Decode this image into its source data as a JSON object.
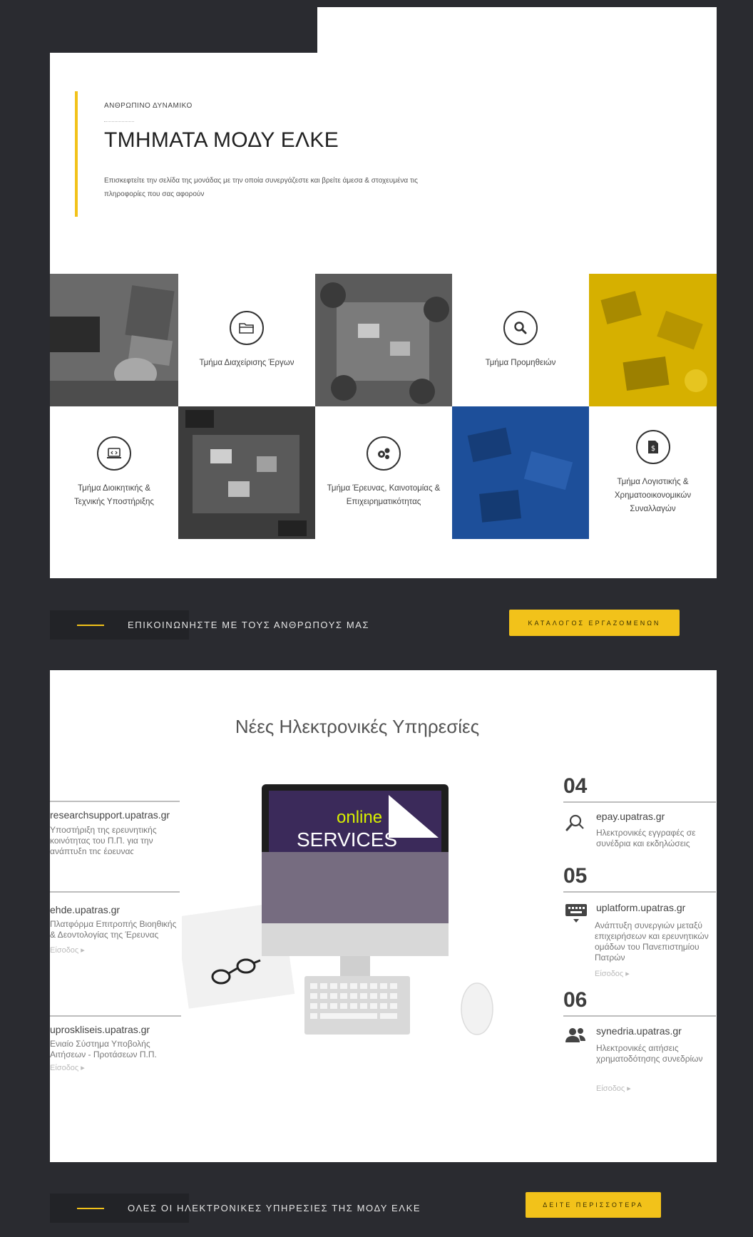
{
  "hero": {
    "eyebrow": "ΑΝΘΡΩΠΙΝΟ ΔΥΝΑΜΙΚΟ",
    "title": "ΤΜΗΜΑΤΑ ΜΟΔΥ ΕΛΚΕ",
    "description": "Επισκεφτείτε την σελίδα της μονάδας με την οποία συνεργάζεστε και βρείτε άμεσα & στοχευμένα τις πληροφορίες που σας αφορούν"
  },
  "departments": [
    {
      "label": "Τμήμα Διαχείρισης Έργων",
      "icon": "folder-icon"
    },
    {
      "label": "Τμήμα Προμηθειών",
      "icon": "search-icon"
    },
    {
      "label": "Τμήμα Διοικητικής & Τεχνικής Υποστήριξης",
      "icon": "laptop-icon"
    },
    {
      "label": "Τμήμα Έρευνας, Καινοτομίας & Επιχειρηματικότητας",
      "icon": "gears-icon"
    },
    {
      "label": "Τμήμα Λογιστικής & Χρηματοοικονομικών Συναλλαγών",
      "icon": "dollar-document-icon"
    }
  ],
  "band1": {
    "text": "ΕΠΙΚΟΙΝΩΝΗΣΤΕ ΜΕ ΤΟΥΣ ΑΝΘΡΩΠΟΥΣ ΜΑΣ",
    "button": "ΚΑΤΑΛΟΓΟΣ ΕΡΓΑΖΟΜΕΝΩΝ"
  },
  "services": {
    "title": "Νέες Ηλεκτρονικές Υπηρεσίες",
    "screen_line1": "online",
    "screen_line2": "SERVICES",
    "left": [
      {
        "url": "researchsupport.upatras.gr",
        "desc": "Υποστήριξη της ερευνητικής κοινότητας του Π.Π. για την ανάπτυξη της έρευνας"
      },
      {
        "url": "ehde.upatras.gr",
        "desc": "Πλατφόρμα Επιτροπής Βιοηθικής & Δεοντολογίας της Έρευνας",
        "link": "Είσοδος ▸"
      },
      {
        "url": "uproskliseis.upatras.gr",
        "desc": "Ενιαίο Σύστημα Υποβολής Αιτήσεων - Προτάσεων Π.Π.",
        "link": "Είσοδος ▸"
      }
    ],
    "right": [
      {
        "number": "04",
        "url": "epay.upatras.gr",
        "desc": "Ηλεκτρονικές εγγραφές σε συνέδρια και εκδηλώσεις",
        "icon": "search-icon"
      },
      {
        "number": "05",
        "url": "uplatform.upatras.gr",
        "desc": "Ανάπτυξη συνεργιών μεταξύ επιχειρήσεων και ερευνητικών ομάδων του Πανεπιστημίου Πατρών",
        "link": "Είσοδος ▸",
        "icon": "keyboard-icon"
      },
      {
        "number": "06",
        "url": "synedria.upatras.gr",
        "desc": "Ηλεκτρονικές αιτήσεις χρηματοδότησης συνεδρίων",
        "link": "Είσοδος ▸",
        "icon": "users-icon"
      }
    ]
  },
  "band2": {
    "text": "ΟΛΕΣ ΟΙ ΗΛΕΚΤΡΟΝΙΚΕΣ ΥΠΗΡΕΣΙΕΣ ΤΗΣ ΜΟΔΥ ΕΛΚΕ",
    "button": "ΔΕΙΤΕ ΠΕΡΙΣΣΟΤΕΡΑ"
  },
  "colors": {
    "accent": "#f2c21a",
    "dark": "#2a2b30",
    "blue_tile": "#1d4f9a",
    "yellow_tile": "#d6b000"
  }
}
